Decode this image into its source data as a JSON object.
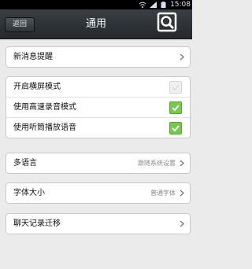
{
  "status_bar": {
    "time": "15:08"
  },
  "header": {
    "back_label": "返回",
    "title": "通用"
  },
  "groups": [
    {
      "items": [
        {
          "label": "新消息提醒"
        }
      ]
    },
    {
      "items": [
        {
          "label": "开启横屏模式",
          "checked": false
        },
        {
          "label": "使用高速录音模式",
          "checked": true
        },
        {
          "label": "使用听筒播放语音",
          "checked": true
        }
      ]
    },
    {
      "items": [
        {
          "label": "多语言",
          "value": "跟随系统设置"
        }
      ]
    },
    {
      "items": [
        {
          "label": "字体大小",
          "value": "普通字体"
        }
      ]
    },
    {
      "items": [
        {
          "label": "聊天记录迁移"
        }
      ]
    }
  ],
  "colors": {
    "accent_green": "#78c850",
    "header_bg": "#2f3337"
  }
}
